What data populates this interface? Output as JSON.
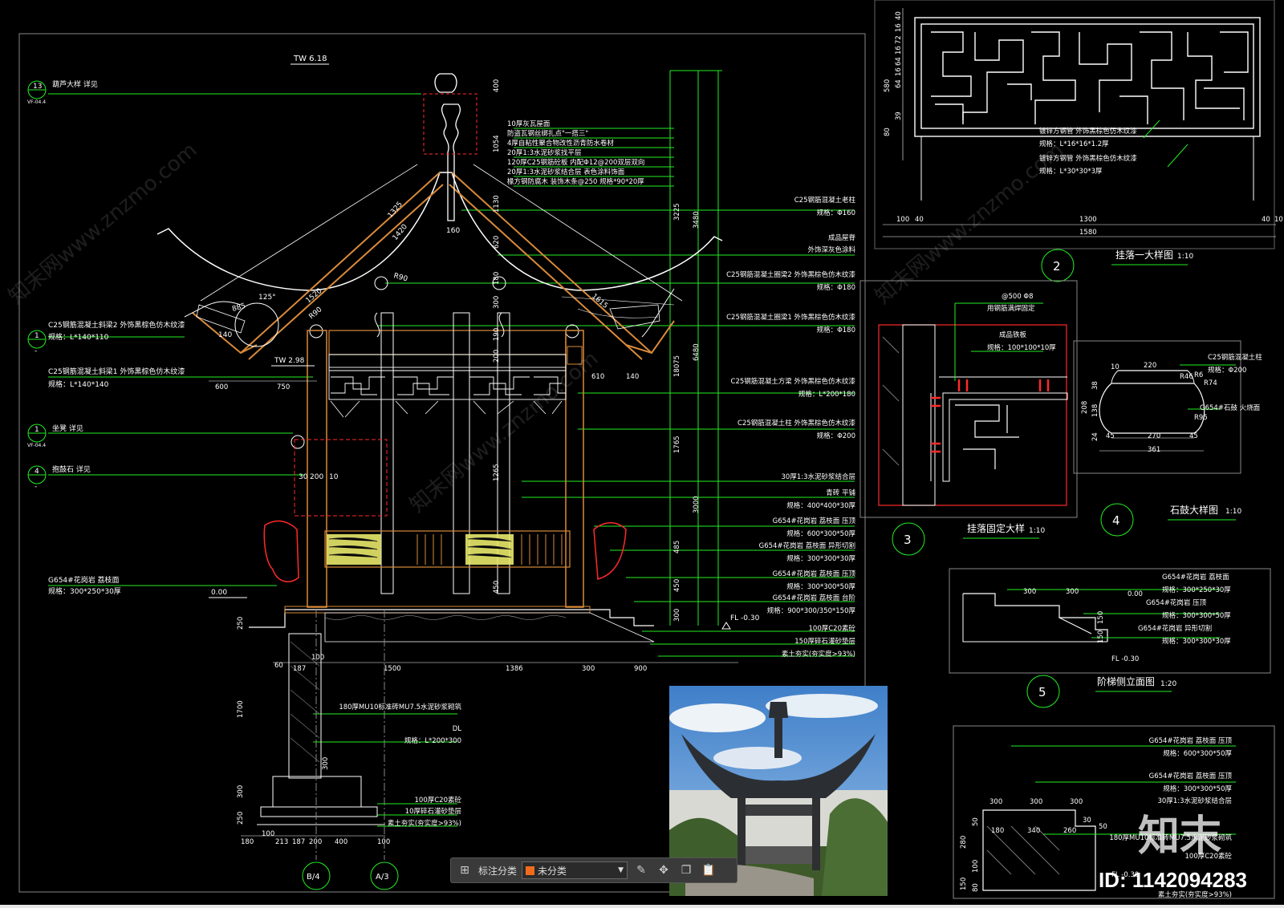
{
  "main_elevation": {
    "top_label": "TW 6.18",
    "eave_label": "TW 2.98",
    "ground_label": "0.00",
    "fl_label": "FL -0.30",
    "callouts": [
      {
        "num": "13",
        "ref": "VF-04.4",
        "text": "葫芦大样  详见"
      },
      {
        "num": "1",
        "ref": "-",
        "text": ""
      },
      {
        "num": "1",
        "ref": "VF-04.4",
        "text": "坐凳  详见"
      },
      {
        "num": "4",
        "ref": "-",
        "text": "抱鼓石  详见"
      }
    ],
    "left_notes": [
      {
        "line1": "C25钢筋混凝土斜梁2  外饰黑棕色仿木纹漆",
        "line2": "规格：L*140*110"
      },
      {
        "line1": "C25钢筋混凝土斜梁1  外饰黑棕色仿木纹漆",
        "line2": "规格：L*140*140"
      },
      {
        "line1": "G654#花岗岩  荔枝面",
        "line2": "规格：300*250*30厚"
      }
    ],
    "roof_layers": [
      "10厚灰瓦屋面",
      "防盗瓦钢丝绑扎点\"一搭三\"",
      "4厚自粘性聚合物改性沥青防水卷材",
      "20厚1:3水泥砂浆找平层",
      "120厚C25钢筋砼板  内配Φ12@200双层双向",
      "20厚1:3水泥砂浆结合层  表色涂料饰面",
      "椽方钢防腐木  装饰木条@250  规格*90*20厚"
    ],
    "right_notes": [
      {
        "line1": "C25钢筋混凝土老柱",
        "line2": "规格：Φ160"
      },
      {
        "line1": "成品屋脊",
        "line2": "外饰深灰色涂料"
      },
      {
        "line1": "C25钢筋混凝土圈梁2  外饰黑棕色仿木纹漆",
        "line2": "规格：Φ180"
      },
      {
        "line1": "C25钢筋混凝土圈梁1  外饰黑棕色仿木纹漆",
        "line2": "规格：Φ180"
      },
      {
        "line1": "C25钢筋混凝土方梁  外饰黑棕色仿木纹漆",
        "line2": "规格：L*200*180"
      },
      {
        "line1": "C25钢筋混凝土柱  外饰黑棕色仿木纹漆",
        "line2": "规格：Φ200"
      },
      {
        "line1": "30厚1:3水泥砂浆结合层",
        "line2": ""
      },
      {
        "line1": "青砖  平铺",
        "line2": "规格：400*400*30厚"
      },
      {
        "line1": "G654#花岗岩  荔枝面  压顶",
        "line2": "规格：600*300*50厚"
      },
      {
        "line1": "G654#花岗岩  荔枝面  异形切割",
        "line2": "规格：300*300*30厚"
      },
      {
        "line1": "G654#花岗岩  荔枝面  压顶",
        "line2": "规格：300*300*50厚"
      },
      {
        "line1": "G654#花岗岩  荔枝面  台阶",
        "line2": "规格：900*300/350*150厚"
      },
      {
        "line1": "100厚C20素砼",
        "line2": ""
      },
      {
        "line1": "150厚碎石灌砂垫层",
        "line2": ""
      },
      {
        "line1": "素土夯实(夯实度>93%)",
        "line2": ""
      }
    ],
    "foundation_notes": [
      "180厚MU10标准砖MU7.5水泥砂浆砌筑",
      "DL",
      "规格：L*200*300",
      "100厚C20素砼",
      "10厚碎石灌砂垫层",
      "素土夯实(夯实度>93%)"
    ],
    "vertical_dims": [
      "400",
      "1054",
      "3225",
      "3480",
      "1130",
      "620",
      "180",
      "300",
      "190",
      "200",
      "18075",
      "6480",
      "1765",
      "1265",
      "3000",
      "485",
      "450",
      "450",
      "300",
      "250",
      "1700",
      "300",
      "300",
      "250"
    ],
    "horizontal_dims": [
      "600",
      "750",
      "610",
      "140",
      "60",
      "187",
      "100",
      "1500",
      "1386",
      "300",
      "900",
      "180",
      "100",
      "213",
      "187",
      "200",
      "400",
      "100"
    ],
    "roof_dims": [
      "1325",
      "1420",
      "R90",
      "160",
      "1520",
      "885",
      "125°",
      "1615",
      "R90",
      "140",
      "200",
      "10",
      "30"
    ],
    "axis_labels": [
      "B/4",
      "A/3"
    ]
  },
  "detail_2": {
    "num": "2",
    "title": "挂落一大样图",
    "scale": "1:10",
    "notes": [
      {
        "line1": "镀锌方钢管  外饰黑棕色仿木纹漆",
        "line2": "规格：L*16*16*1.2厚"
      },
      {
        "line1": "镀锌方钢管  外饰黑棕色仿木纹漆",
        "line2": "规格：L*30*30*3厚"
      }
    ],
    "dims_bottom": [
      "100",
      "40",
      "1300",
      "1580",
      "40",
      "10"
    ],
    "dims_left": [
      "40",
      "16",
      "72",
      "16",
      "64",
      "16",
      "64",
      "16",
      "64",
      "580",
      "16",
      "64",
      "16",
      "39",
      "80"
    ]
  },
  "detail_3": {
    "num": "3",
    "title": "挂落固定大样",
    "scale": "1:10",
    "notes": [
      "@500  Φ8",
      "用钢筋满焊固定",
      "成品铁板",
      "规格：100*100*10厚"
    ]
  },
  "detail_4": {
    "num": "4",
    "title": "石鼓大样图",
    "scale": "1:10",
    "notes": [
      {
        "line1": "C25钢筋混凝土柱",
        "line2": "规格：Φ200"
      },
      {
        "line1": "G654#石鼓  火烧面",
        "line2": ""
      }
    ],
    "dims": [
      "220",
      "10",
      "R46",
      "R6",
      "R74",
      "R95",
      "38",
      "208",
      "138",
      "24",
      "45",
      "270",
      "45",
      "361"
    ]
  },
  "detail_5": {
    "num": "5",
    "title": "阶梯侧立面图",
    "scale": "1:20",
    "ground": "0.00",
    "fl": "FL -0.30",
    "notes": [
      {
        "line1": "G654#花岗岩  荔枝面",
        "line2": "规格：300*250*30厚"
      },
      {
        "line1": "G654#花岗岩  压顶",
        "line2": "规格：300*300*50厚"
      },
      {
        "line1": "G654#花岗岩  异形切割",
        "line2": "规格：300*300*30厚"
      }
    ],
    "dims": [
      "300",
      "300",
      "150",
      "150"
    ]
  },
  "detail_6": {
    "notes": [
      {
        "line1": "G654#花岗岩  荔枝面  压顶",
        "line2": "规格：600*300*50厚"
      },
      {
        "line1": "G654#花岗岩  荔枝面  压顶",
        "line2": "规格：300*300*50厚"
      },
      {
        "line1": "30厚1:3水泥砂浆结合层",
        "line2": ""
      },
      {
        "line1": "180厚MU10标准砖MU7.5水泥砂浆砌筑",
        "line2": ""
      },
      {
        "line1": "100厚C20素砼",
        "line2": ""
      },
      {
        "line1": "素土夯实(夯实度>93%)",
        "line2": ""
      }
    ],
    "dims": [
      "300",
      "300",
      "300",
      "30",
      "50",
      "180",
      "340",
      "260",
      "50",
      "280",
      "100",
      "150",
      "80"
    ],
    "fl": "FL -0.30"
  },
  "toolbar": {
    "category_label": "标注分类",
    "selected_value": "未分类",
    "swatch_color": "#f26b1d"
  },
  "watermark": {
    "id_text": "ID: 1142094283",
    "logo_text": "知末",
    "site_text": "知末网www.znzmo.com"
  },
  "colors": {
    "line_green": "#22ee22",
    "line_white": "#ffffff",
    "pavilion_orange": "#d98a3a",
    "railing_yellow": "#e8e86a",
    "red_marks": "#ff2a2a",
    "background": "#000000"
  }
}
